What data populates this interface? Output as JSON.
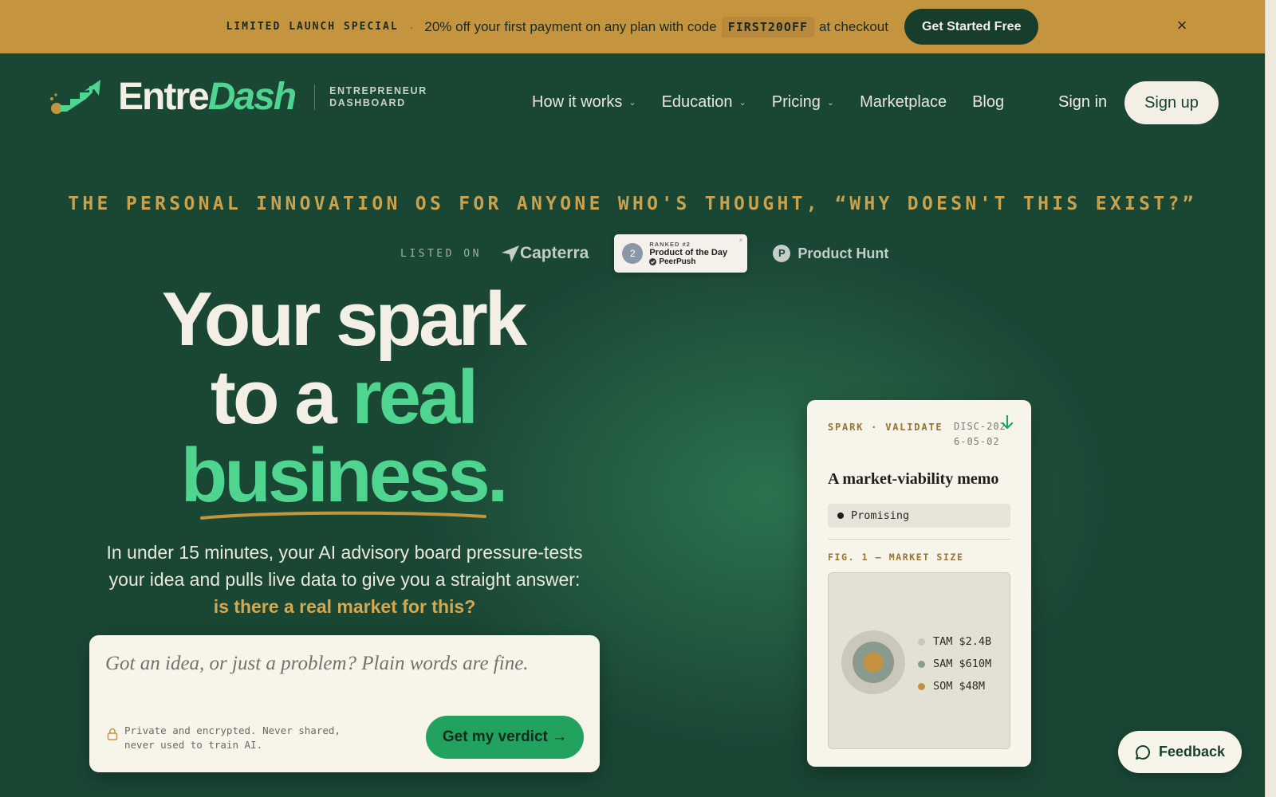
{
  "promo": {
    "tag": "LIMITED LAUNCH SPECIAL",
    "separator": "·",
    "text_before": "20% off your first payment on any plan with code",
    "code": "FIRST20OFF",
    "text_after": "at checkout",
    "cta": "Get Started Free",
    "close": "×"
  },
  "brand": {
    "name_part1": "Entre",
    "name_part2": "Dash",
    "sub_line1": "ENTREPRENEUR",
    "sub_line2": "DASHBOARD"
  },
  "nav": {
    "items": [
      {
        "label": "How it works",
        "dropdown": true
      },
      {
        "label": "Education",
        "dropdown": true
      },
      {
        "label": "Pricing",
        "dropdown": true
      },
      {
        "label": "Marketplace",
        "dropdown": false
      },
      {
        "label": "Blog",
        "dropdown": false
      }
    ],
    "chevron": "⌄",
    "signin": "Sign in",
    "signup": "Sign up"
  },
  "tagline": "THE PERSONAL INNOVATION OS FOR ANYONE WHO'S THOUGHT, “WHY DOESN'T THIS EXIST?”",
  "listed": {
    "label": "LISTED ON",
    "capterra": "Capterra",
    "peerpush": {
      "rank": "RANKED #2",
      "title": "Product of the Day",
      "brand": "PeerPush",
      "medal": "2",
      "close": "×"
    },
    "producthunt": {
      "icon_letter": "P",
      "label": "Product Hunt"
    }
  },
  "hero": {
    "line1": "Your spark",
    "line2_a": "to a ",
    "line2_b": "real",
    "line3": "business.",
    "sub": "In under 15 minutes, your AI advisory board pressure-tests your idea and pulls live data to give you a straight answer: ",
    "sub_highlight": "is there a real market for this?"
  },
  "idea_card": {
    "placeholder": "Got an idea, or just a problem? Plain words are fine.",
    "value": "",
    "privacy": "Private and encrypted. Never shared, never used to train AI.",
    "cta": "Get my verdict →"
  },
  "memo": {
    "kicker": "SPARK · VALIDATE",
    "doc_id": "DISC-2026-05-02",
    "title": "A market-viability memo",
    "status": "Promising",
    "figure_label": "FIG. 1 — MARKET SIZE",
    "legend": [
      {
        "label": "TAM $2.4B",
        "color": "#c9c8bb"
      },
      {
        "label": "SAM $610M",
        "color": "#8a9a8c"
      },
      {
        "label": "SOM $48M",
        "color": "#c4913e"
      }
    ]
  },
  "feedback": {
    "label": "Feedback"
  },
  "colors": {
    "background": "#1a4634",
    "promo": "#c4943f",
    "accent_green": "#4fd58f",
    "cta_green": "#21a35f",
    "gold": "#c9a250",
    "cream": "#f3efe4"
  }
}
